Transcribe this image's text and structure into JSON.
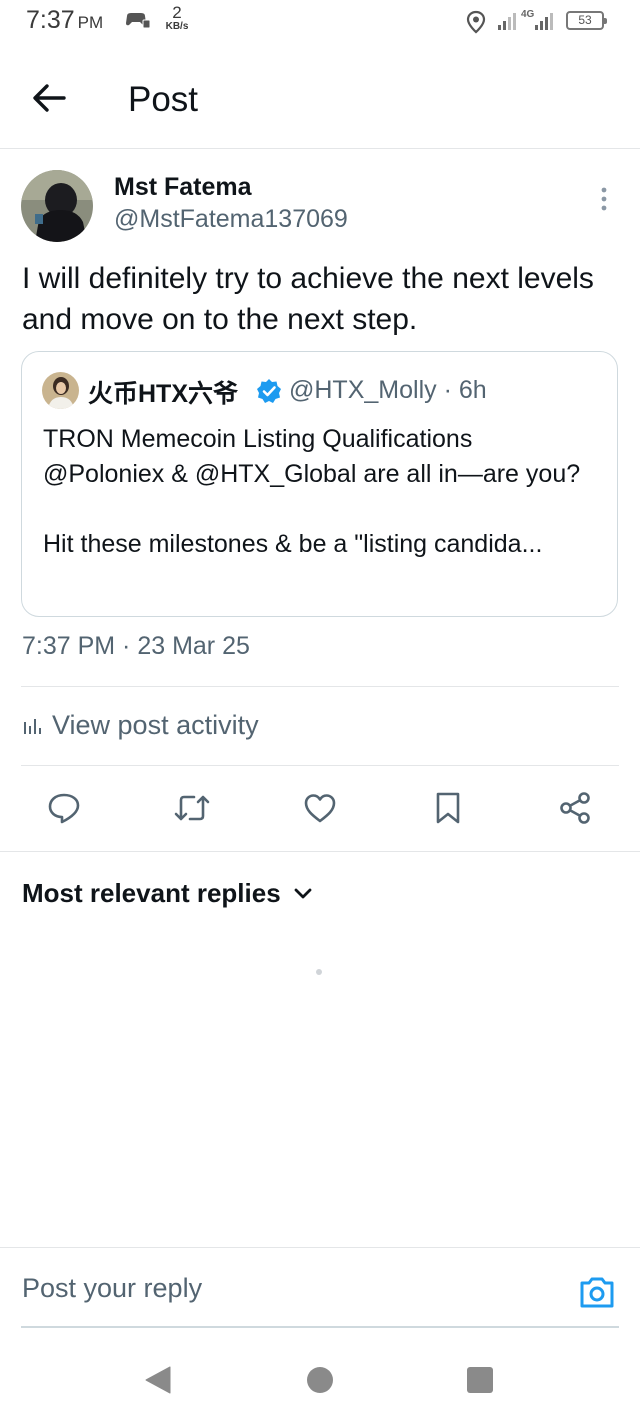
{
  "status_bar": {
    "time": "7:37",
    "ampm": "PM",
    "speed_value": "2",
    "speed_unit": "KB/s",
    "network": "4G",
    "battery": "53"
  },
  "header": {
    "title": "Post"
  },
  "post": {
    "author_name": "Mst Fatema",
    "author_handle": "@MstFatema137069",
    "text": "I will definitely try to achieve the next levels and move on to the next step.",
    "timestamp": "7:37 PM · 23 Mar 25"
  },
  "quoted": {
    "name": "火币HTX六爷",
    "handle_time": "@HTX_Molly · 6h",
    "text": "TRON Memecoin Listing Qualifications\n@Poloniex & @HTX_Global  are all in—are you?\n\nHit these milestones & be a \"listing candida..."
  },
  "activity_label": "View post activity",
  "actions": [
    "reply-icon",
    "retweet-icon",
    "like-icon",
    "bookmark-icon",
    "share-icon"
  ],
  "replies_sort_label": "Most relevant replies",
  "reply_placeholder": "Post your reply",
  "colors": {
    "accent": "#1d9bf0",
    "text_primary": "#0f1419",
    "text_secondary": "#536471",
    "border": "#cfd9de"
  }
}
